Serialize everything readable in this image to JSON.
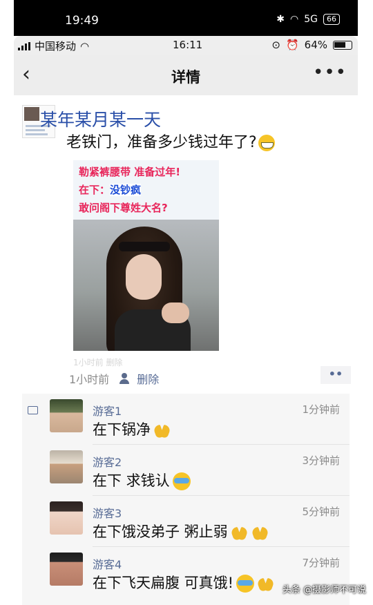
{
  "outer_status": {
    "time": "19:49",
    "battery": "66",
    "network": "5G"
  },
  "status": {
    "carrier": "中国移动",
    "time": "16:11",
    "battery": "64%"
  },
  "nav": {
    "back_icon": "chevron-left-icon",
    "title": "详情",
    "more_icon": "more-dots-icon"
  },
  "post": {
    "author": "某年某月某一天",
    "text": "老铁门，准备多少钱过年了?",
    "text_emoji": "grin-emoji",
    "image": {
      "line1": "勒紧裤腰带 准备过年!",
      "line2_prefix": "在下：",
      "line2_highlight": "没钞疯",
      "line3": "敢问阁下尊姓大名?"
    },
    "faded_meta": "1小时前   删除",
    "time": "1小时前",
    "delete": "删除",
    "more": "••"
  },
  "comments": [
    {
      "name": "游客1",
      "time": "1分钟前",
      "text": "在下锅净",
      "emojis": [
        "clasped-hands"
      ]
    },
    {
      "name": "游客2",
      "time": "3分钟前",
      "text": "在下 求钱认",
      "emojis": [
        "crying-face"
      ]
    },
    {
      "name": "游客3",
      "time": "5分钟前",
      "text": "在下饿没弟子 粥止弱",
      "emojis": [
        "clasped-hands",
        "clasped-hands"
      ]
    },
    {
      "name": "游客4",
      "time": "7分钟前",
      "text": "在下飞天扁腹 可真饿!",
      "emojis": [
        "crying-face",
        "clasped-hands"
      ]
    }
  ],
  "watermark": "头条 @摄影师不可说"
}
